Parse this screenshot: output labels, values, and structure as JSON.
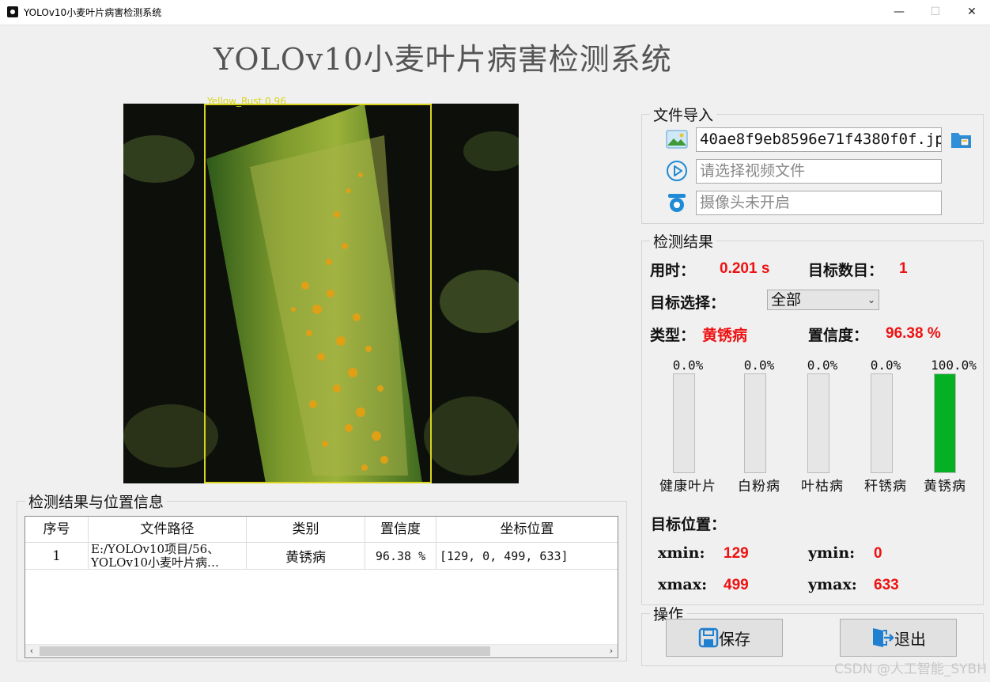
{
  "window": {
    "title": "YOLOv10小麦叶片病害检测系统",
    "minimize": "—",
    "maximize": "☐",
    "close": "✕"
  },
  "main_title": "YOLOv10小麦叶片病害检测系统",
  "image": {
    "detection_label": "Yellow_Rust 0.96",
    "box_color": "#d8d41e"
  },
  "results_table": {
    "legend": "检测结果与位置信息",
    "headers": [
      "序号",
      "文件路径",
      "类别",
      "置信度",
      "坐标位置"
    ],
    "rows": [
      {
        "index": "1",
        "path": "E:/YOLOv10项目/56、YOLOv10小麦叶片病…",
        "category": "黄锈病",
        "confidence": "96.38 %",
        "coords": "[129, 0, 499, 633]"
      }
    ]
  },
  "file_import": {
    "legend": "文件导入",
    "image_file": "40ae8f9eb8596e71f4380f0f.jpg",
    "video_placeholder": "请选择视频文件",
    "camera_status": "摄像头未开启"
  },
  "detection": {
    "legend": "检测结果",
    "time_label": "用时：",
    "time_value": "0.201 s",
    "count_label": "目标数目：",
    "count_value": "1",
    "select_label": "目标选择：",
    "select_value": "全部",
    "type_label": "类型：",
    "type_value": "黄锈病",
    "conf_label": "置信度：",
    "conf_value": "96.38 %"
  },
  "class_bars": [
    {
      "name": "健康叶片",
      "pct_text": "0.0%",
      "value": 0
    },
    {
      "name": "白粉病",
      "pct_text": "0.0%",
      "value": 0
    },
    {
      "name": "叶枯病",
      "pct_text": "0.0%",
      "value": 0
    },
    {
      "name": "秆锈病",
      "pct_text": "0.0%",
      "value": 0
    },
    {
      "name": "黄锈病",
      "pct_text": "100.0%",
      "value": 100
    }
  ],
  "position": {
    "title": "目标位置：",
    "xmin_label": "xmin:",
    "xmin": "129",
    "ymin_label": "ymin:",
    "ymin": "0",
    "xmax_label": "xmax:",
    "xmax": "499",
    "ymax_label": "ymax:",
    "ymax": "633"
  },
  "operations": {
    "legend": "操作",
    "save": "保存",
    "exit": "退出"
  },
  "watermark": "CSDN @人工智能_SYBH",
  "colors": {
    "accent_red": "#ee1111",
    "bar_green": "#06b025"
  }
}
